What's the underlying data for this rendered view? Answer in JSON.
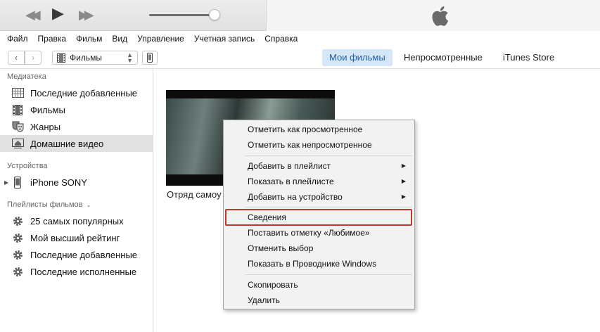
{
  "menubar": [
    "Файл",
    "Правка",
    "Фильм",
    "Вид",
    "Управление",
    "Учетная запись",
    "Справка"
  ],
  "toolbar": {
    "back_glyph": "‹",
    "forward_glyph": "›",
    "media_label": "Фильмы",
    "tabs": [
      "Мои фильмы",
      "Непросмотренные",
      "iTunes Store"
    ],
    "active_tab": "Мои фильмы"
  },
  "sidebar": {
    "library_title": "Медиатека",
    "library_items": [
      "Последние добавленные",
      "Фильмы",
      "Жанры",
      "Домашние видео"
    ],
    "selected_item": "Домашние видео",
    "devices_title": "Устройства",
    "devices": [
      "iPhone SONY"
    ],
    "playlists_title": "Плейлисты фильмов",
    "playlists": [
      "25 самых популярных",
      "Мой высший рейтинг",
      "Последние добавленные",
      "Последние исполненные"
    ]
  },
  "content": {
    "movie_title": "Отряд самоу"
  },
  "context_menu": {
    "items": [
      {
        "label": "Отметить как просмотренное",
        "submenu": false
      },
      {
        "label": "Отметить как непросмотренное",
        "submenu": false
      },
      {
        "label": "Добавить в плейлист",
        "submenu": true
      },
      {
        "label": "Показать в плейлисте",
        "submenu": true
      },
      {
        "label": "Добавить на устройство",
        "submenu": true
      },
      {
        "label": "Сведения",
        "submenu": false,
        "highlighted": true
      },
      {
        "label": "Поставить отметку «Любимое»",
        "submenu": false
      },
      {
        "label": "Отменить выбор",
        "submenu": false
      },
      {
        "label": "Показать в Проводнике Windows",
        "submenu": false
      },
      {
        "label": "Скопировать",
        "submenu": false
      },
      {
        "label": "Удалить",
        "submenu": false
      }
    ],
    "highlight_color": "#c0392b"
  },
  "colors": {
    "active_tab_bg": "#d5e6f7",
    "active_tab_text": "#1f5fa8",
    "selected_sidebar_bg": "#e1e1e1"
  },
  "icons": {
    "player": [
      "rewind-icon",
      "play-icon",
      "fast-forward-icon"
    ],
    "brand": "apple-logo-icon",
    "library": [
      "grid-icon",
      "film-icon",
      "masks-icon",
      "home-video-icon"
    ],
    "device": "iphone-icon",
    "playlist": "gear-icon"
  }
}
